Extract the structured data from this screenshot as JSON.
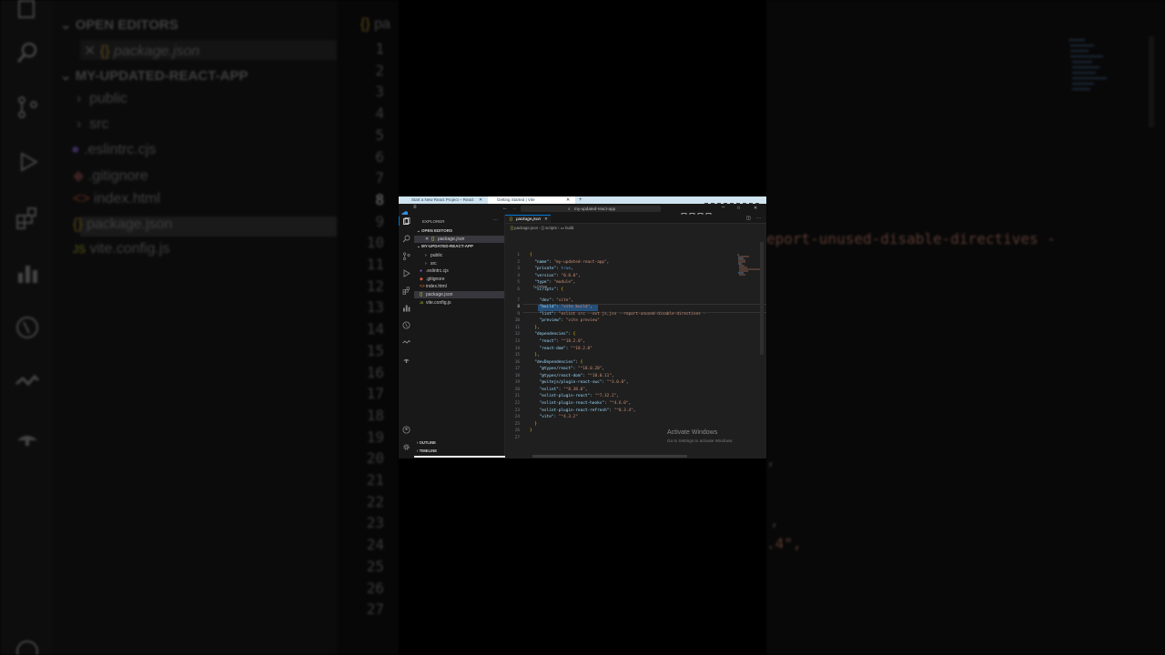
{
  "background": {
    "sections": [
      "OPEN EDITORS",
      "MY-UPDATED-REACT-APP"
    ],
    "open_file": "package.json",
    "tree": [
      "public",
      "src",
      ".eslintrc.cjs",
      ".gitignore",
      "index.html",
      "package.json",
      "vite.config.js"
    ],
    "tab_label": "pa",
    "line_numbers": [
      "1",
      "2",
      "3",
      "4",
      "5",
      "6",
      "7",
      "8",
      "9",
      "10",
      "11",
      "12",
      "13",
      "14",
      "15",
      "16",
      "17",
      "18",
      "19",
      "20",
      "21",
      "22",
      "23",
      "24",
      "25",
      "26",
      "27"
    ],
    "right_fragments": [
      "eport-unused-disable-directives -",
      ",",
      ",",
      ".4\","
    ]
  },
  "browser_tabs": [
    "Start a New React Project – React",
    "Getting Started | Vite"
  ],
  "vscode": {
    "search_text": "my-updated-react-app",
    "explorer_title": "EXPLORER",
    "open_editors_label": "OPEN EDITORS",
    "project_label": "MY-UPDATED-REACT-APP",
    "open_editor_file": "package.json",
    "tree": [
      {
        "name": "public",
        "type": "folder"
      },
      {
        "name": "src",
        "type": "folder"
      },
      {
        "name": ".eslintrc.cjs",
        "type": "eslint"
      },
      {
        "name": ".gitignore",
        "type": "git"
      },
      {
        "name": "index.html",
        "type": "html"
      },
      {
        "name": "package.json",
        "type": "json"
      },
      {
        "name": "vite.config.js",
        "type": "js"
      }
    ],
    "outline_label": "OUTLINE",
    "timeline_label": "TIMELINE",
    "editor_tab": "package.json",
    "breadcrumb": [
      "package.json",
      "{} scripts",
      "build"
    ],
    "debug_hint": "Debug",
    "code_lines": [
      "{",
      "  \"name\": \"my-updated-react-app\",",
      "  \"private\": true,",
      "  \"version\": \"0.0.0\",",
      "  \"type\": \"module\",",
      "  \"scripts\": {",
      "    \"dev\": \"vite\",",
      "    \"build\": \"vite build\",",
      "    \"lint\": \"eslint src --ext js,jsx --report-unused-disable-directives -",
      "    \"preview\": \"vite preview\"",
      "  },",
      "  \"dependencies\": {",
      "    \"react\": \"^18.2.0\",",
      "    \"react-dom\": \"^18.2.0\"",
      "  },",
      "  \"devDependencies\": {",
      "    \"@types/react\": \"^18.0.28\",",
      "    \"@types/react-dom\": \"^18.0.11\",",
      "    \"@vitejs/plugin-react-swc\": \"^3.0.0\",",
      "    \"eslint\": \"^8.38.0\",",
      "    \"eslint-plugin-react\": \"^7.32.2\",",
      "    \"eslint-plugin-react-hooks\": \"^4.6.0\",",
      "    \"eslint-plugin-react-refresh\": \"^0.3.4\",",
      "    \"vite\": \"^4.3.2\"",
      "  }",
      "}",
      ""
    ],
    "activate_title": "Activate Windows",
    "activate_sub": "Go to Settings to activate Windows."
  }
}
